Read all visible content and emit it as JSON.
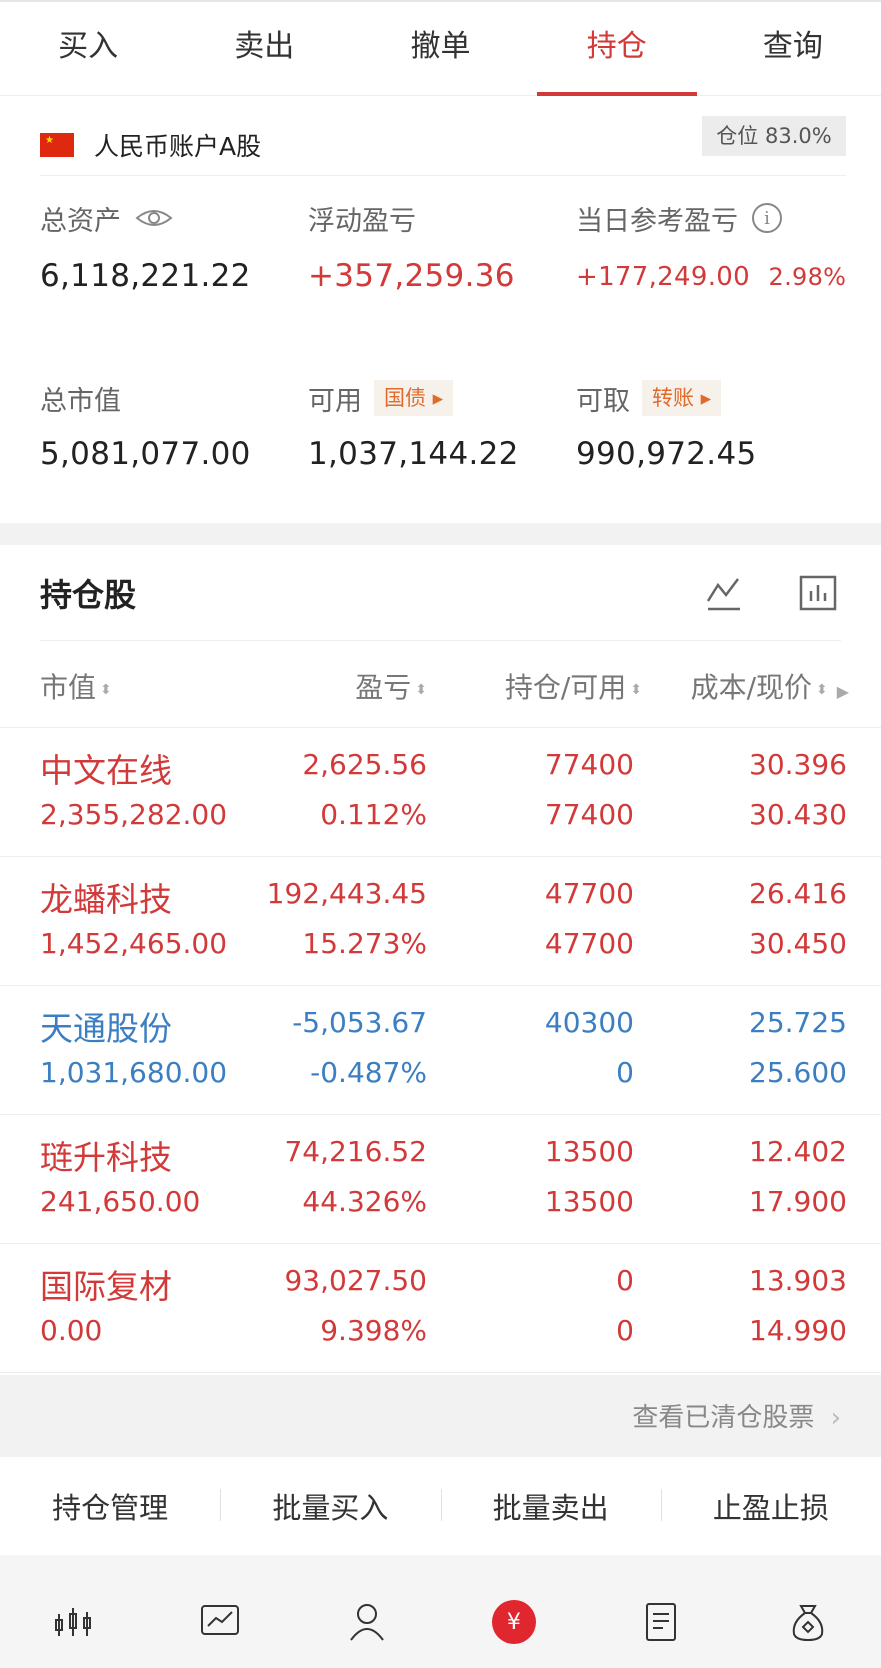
{
  "tabs": [
    "买入",
    "卖出",
    "撤单",
    "持仓",
    "查询"
  ],
  "account": {
    "name": "人民币账户A股",
    "position_ratio": "仓位 83.0%"
  },
  "summary": {
    "total_assets_label": "总资产",
    "total_assets": "6,118,221.22",
    "float_pl_label": "浮动盈亏",
    "float_pl": "+357,259.36",
    "day_pl_label": "当日参考盈亏",
    "day_pl": "+177,249.00",
    "day_pl_pct": "2.98%",
    "market_value_label": "总市值",
    "market_value": "5,081,077.00",
    "available_label": "可用",
    "available_chip": "国债",
    "available": "1,037,144.22",
    "withdrawable_label": "可取",
    "withdrawable_chip": "转账",
    "withdrawable": "990,972.45"
  },
  "holdings": {
    "title": "持仓股",
    "columns": [
      "市值",
      "盈亏",
      "持仓/可用",
      "成本/现价"
    ],
    "rows": [
      {
        "name": "中文在线",
        "market_value": "2,355,282.00",
        "pl": "2,625.56",
        "pl_pct": "0.112%",
        "hold": "77400",
        "avail": "77400",
        "cost": "30.396",
        "price": "30.430",
        "dir": "up"
      },
      {
        "name": "龙蟠科技",
        "market_value": "1,452,465.00",
        "pl": "192,443.45",
        "pl_pct": "15.273%",
        "hold": "47700",
        "avail": "47700",
        "cost": "26.416",
        "price": "30.450",
        "dir": "up"
      },
      {
        "name": "天通股份",
        "market_value": "1,031,680.00",
        "pl": "-5,053.67",
        "pl_pct": "-0.487%",
        "hold": "40300",
        "avail": "0",
        "cost": "25.725",
        "price": "25.600",
        "dir": "down"
      },
      {
        "name": "琏升科技",
        "market_value": "241,650.00",
        "pl": "74,216.52",
        "pl_pct": "44.326%",
        "hold": "13500",
        "avail": "13500",
        "cost": "12.402",
        "price": "17.900",
        "dir": "up"
      },
      {
        "name": "国际复材",
        "market_value": "0.00",
        "pl": "93,027.50",
        "pl_pct": "9.398%",
        "hold": "0",
        "avail": "0",
        "cost": "13.903",
        "price": "14.990",
        "dir": "up"
      }
    ],
    "cleared_link": "查看已清仓股票"
  },
  "actions": [
    "持仓管理",
    "批量买入",
    "批量卖出",
    "止盈止损"
  ],
  "colors": {
    "up": "#d23a3a",
    "down": "#3b7fc2",
    "accent": "#d23a3a"
  },
  "nav_icons": [
    "candlestick-icon",
    "chart-icon",
    "user-icon",
    "yen-icon",
    "document-icon",
    "money-bag-icon"
  ]
}
